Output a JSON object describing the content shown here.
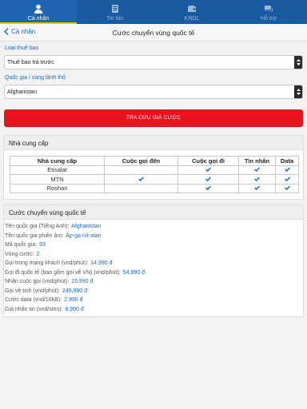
{
  "tabs": [
    {
      "label": "Cá nhân",
      "icon": "person-icon",
      "active": true
    },
    {
      "label": "Tin tức",
      "icon": "news-icon",
      "active": false
    },
    {
      "label": "KNDL",
      "icon": "wallet-icon",
      "active": false
    },
    {
      "label": "Hỗ trợ",
      "icon": "chat-icon",
      "active": false
    }
  ],
  "nav": {
    "back_label": "Cá nhân",
    "title": "Cước chuyển vùng quốc tế"
  },
  "form": {
    "subscriber_label": "Loại thuê bao",
    "subscriber_value": "Thuê bao trả trước",
    "country_label": "Quốc gia / vùng lãnh thổ",
    "country_value": "Afghanistan",
    "search_button": "TRA CỨU GIÁ CƯỚC"
  },
  "providers": {
    "title": "Nhà cung cấp",
    "headers": [
      "Nhà cung cấp",
      "Cuộc gọi đến",
      "Cuộc gọi đi",
      "Tin nhắn",
      "Data"
    ],
    "rows": [
      {
        "name": "Etisalat",
        "incoming": false,
        "outgoing": true,
        "sms": true,
        "data": true
      },
      {
        "name": "MTN",
        "incoming": true,
        "outgoing": true,
        "sms": true,
        "data": true
      },
      {
        "name": "Roshan",
        "incoming": false,
        "outgoing": true,
        "sms": true,
        "data": true
      }
    ]
  },
  "rates": {
    "title": "Cước chuyển vùng quốc tế",
    "items": [
      {
        "label": "Tên quốc gia (Tiếng Anh):",
        "value": "Afghanistan"
      },
      {
        "label": "Tên quốc gia phiên âm:",
        "value": "Áp-ga-nít-xtan"
      },
      {
        "label": "Mã quốc gia:",
        "value": "93"
      },
      {
        "label": "Vùng cước:",
        "value": "2"
      },
      {
        "label": "Gọi trong mạng khách (vnd/phút):",
        "value": "14,990 đ"
      },
      {
        "label": "Gọi đi quốc tế (bao gồm gọi về VN) (vnd/phút):",
        "value": "54,990 đ"
      },
      {
        "label": "Nhận cuộc gọi (vnd/phút):",
        "value": "15,990 đ"
      },
      {
        "label": "Gọi vệ tinh (vnd/phút):",
        "value": "249,990 đ"
      },
      {
        "label": "Cước data (vnd/10kB):",
        "value": "2,990 đ"
      },
      {
        "label": "Giá nhắn tin (vnd/sms):",
        "value": "8,990 đ"
      }
    ]
  },
  "colors": {
    "header_blue": "#1a5aa0",
    "accent_blue": "#1a68c4",
    "button_red": "#e8141b",
    "tab_indicator": "#f2c200"
  }
}
